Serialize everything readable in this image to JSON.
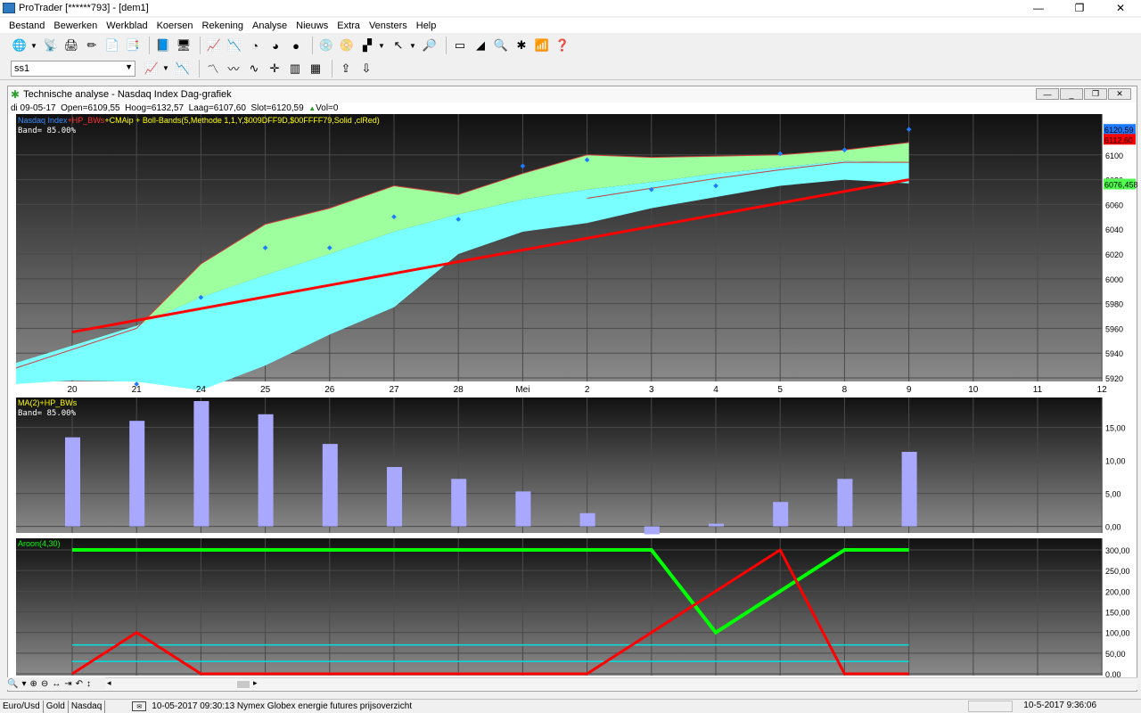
{
  "window": {
    "title": "ProTrader [******793] - [dem1]",
    "minimize": "—",
    "maximize": "❐",
    "close": "✕"
  },
  "menu": [
    "Bestand",
    "Bewerken",
    "Werkblad",
    "Koersen",
    "Rekening",
    "Analyse",
    "Nieuws",
    "Extra",
    "Vensters",
    "Help"
  ],
  "toolbar": {
    "sheet_select": "ss1"
  },
  "chart_window": {
    "title": "Technische analyse -   Nasdaq Index Dag-grafiek"
  },
  "quote": {
    "date": "di 09-05-17",
    "open": "Open=6109,55",
    "high": "Hoog=6132,57",
    "low": "Laag=6107,60",
    "close": "Slot=6120,59",
    "vol": "Vol=0"
  },
  "chart_data": [
    {
      "type": "area",
      "legend": {
        "p1": "Nasdaq Index",
        "p2": "+HP_BWs",
        "p3": "+CMAip",
        "p4": " + Boll-Bands(5,Methode 1,1,Y,$009DFF9D,$00FFFF79,Solid",
        "p5": "   ,clRed)"
      },
      "band_label": "Band=  85.00%",
      "x_labels": [
        "20",
        "21",
        "24",
        "25",
        "26",
        "27",
        "28",
        "Mei",
        "2",
        "3",
        "4",
        "5",
        "8",
        "9",
        "10",
        "11",
        "12"
      ],
      "y_ticks": [
        "6100",
        "6080",
        "6060",
        "6040",
        "6020",
        "6000",
        "5980",
        "5960",
        "5940",
        "5920"
      ],
      "ylim": [
        5920,
        6120
      ],
      "price_labels": {
        "last": "6120,59",
        "red": "6112,60",
        "green": "6076,458"
      },
      "close": [
        5915,
        5985,
        6025,
        6025,
        6050,
        6048,
        6091,
        6096,
        6072,
        6075,
        6101,
        6104,
        6120.59
      ],
      "upper_band": [
        5928,
        5960,
        6012,
        6044,
        6057,
        6075,
        6068,
        6085,
        6100,
        6098,
        6099,
        6100,
        6104,
        6110
      ],
      "lower_band": [
        5915,
        5918,
        5917,
        5910,
        5930,
        5955,
        5977,
        6020,
        6038,
        6045,
        6057,
        6066,
        6075,
        6080,
        6077
      ],
      "middle_line": [
        6065,
        6073,
        6081,
        6088,
        6094,
        6094
      ],
      "trend_line": [
        5957,
        6080
      ]
    },
    {
      "type": "bar",
      "legend": "MA(2)+HP_BWs",
      "band_label": "Band=  85.00%",
      "y_ticks": [
        "15,00",
        "10,00",
        "5,00",
        "0,00"
      ],
      "ylim": [
        -1,
        19
      ],
      "values": [
        13.5,
        16,
        19,
        17,
        12.5,
        9,
        7.2,
        5.3,
        2,
        -1.2,
        0.4,
        3.7,
        7.2,
        11.3
      ]
    },
    {
      "type": "line",
      "legend": "Aroon(4,30)",
      "y_ticks": [
        "300,00",
        "250,00",
        "200,00",
        "150,00",
        "100,00",
        "50,00",
        "0,00"
      ],
      "ylim": [
        0,
        300
      ],
      "green": [
        300,
        300,
        300,
        300,
        300,
        300,
        300,
        300,
        300,
        300,
        100,
        200,
        300,
        300
      ],
      "red": [
        0,
        100,
        0,
        0,
        0,
        0,
        0,
        0,
        0,
        100,
        200,
        300,
        0,
        0
      ],
      "levels": [
        70,
        30
      ]
    }
  ],
  "bottom_tools": [
    "🔍",
    "▾",
    "⊕",
    "⊖",
    "↔",
    "⇥",
    "↶",
    "↕",
    "◂",
    "▸"
  ],
  "status": {
    "tabs": [
      "Euro/Usd",
      "Gold",
      "Nasdaq"
    ],
    "message": "10-05-2017 09:30:13 Nymex Globex energie futures prijsoverzicht",
    "datetime": "10-5-2017 9:36:06"
  },
  "colors": {
    "panel_top": "#111111",
    "panel_bottom": "#8a8a8a",
    "band_upper": "#9dff9d",
    "band_lower": "#79ffff",
    "trend": "#ff0000",
    "bars": "#a8a8ff",
    "aroon_up": "#00ff00",
    "aroon_down": "#ff0000",
    "level": "#00e0e0",
    "price_blue": "#1e7bff"
  }
}
